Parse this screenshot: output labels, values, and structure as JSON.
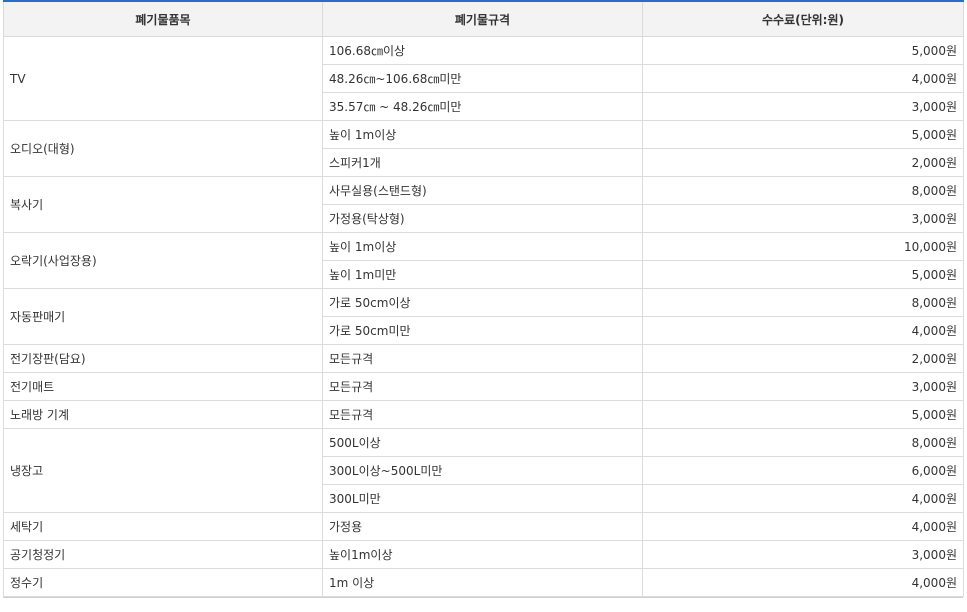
{
  "header": {
    "col_item": "폐기물품목",
    "col_spec": "폐기물규격",
    "col_fee": "수수료(단위:원)"
  },
  "groups": [
    {
      "item": "TV",
      "rows": [
        {
          "spec": "106.68㎝이상",
          "fee": "5,000원"
        },
        {
          "spec": "48.26㎝~106.68㎝미만",
          "fee": "4,000원"
        },
        {
          "spec": "35.57㎝ ~ 48.26㎝미만",
          "fee": "3,000원"
        }
      ]
    },
    {
      "item": "오디오(대형)",
      "rows": [
        {
          "spec": "높이 1m이상",
          "fee": "5,000원"
        },
        {
          "spec": "스피커1개",
          "fee": "2,000원"
        }
      ]
    },
    {
      "item": "복사기",
      "rows": [
        {
          "spec": "사무실용(스탠드형)",
          "fee": "8,000원"
        },
        {
          "spec": "가정용(탁상형)",
          "fee": "3,000원"
        }
      ]
    },
    {
      "item": "오락기(사업장용)",
      "rows": [
        {
          "spec": "높이 1m이상",
          "fee": "10,000원"
        },
        {
          "spec": "높이 1m미만",
          "fee": "5,000원"
        }
      ]
    },
    {
      "item": "자동판매기",
      "rows": [
        {
          "spec": "가로 50cm이상",
          "fee": "8,000원"
        },
        {
          "spec": "가로 50cm미만",
          "fee": "4,000원"
        }
      ]
    },
    {
      "item": "전기장판(담요)",
      "rows": [
        {
          "spec": "모든규격",
          "fee": "2,000원"
        }
      ]
    },
    {
      "item": "전기매트",
      "rows": [
        {
          "spec": "모든규격",
          "fee": "3,000원"
        }
      ]
    },
    {
      "item": "노래방 기계",
      "rows": [
        {
          "spec": "모든규격",
          "fee": "5,000원"
        }
      ]
    },
    {
      "item": "냉장고",
      "rows": [
        {
          "spec": "500L이상",
          "fee": "8,000원"
        },
        {
          "spec": "300L이상~500L미만",
          "fee": "6,000원"
        },
        {
          "spec": "300L미만",
          "fee": "4,000원"
        }
      ]
    },
    {
      "item": "세탁기",
      "rows": [
        {
          "spec": "가정용",
          "fee": "4,000원"
        }
      ]
    },
    {
      "item": "공기청정기",
      "rows": [
        {
          "spec": "높이1m이상",
          "fee": "3,000원"
        }
      ]
    },
    {
      "item": "정수기",
      "rows": [
        {
          "spec": "1m 이상",
          "fee": "4,000원"
        }
      ]
    }
  ]
}
